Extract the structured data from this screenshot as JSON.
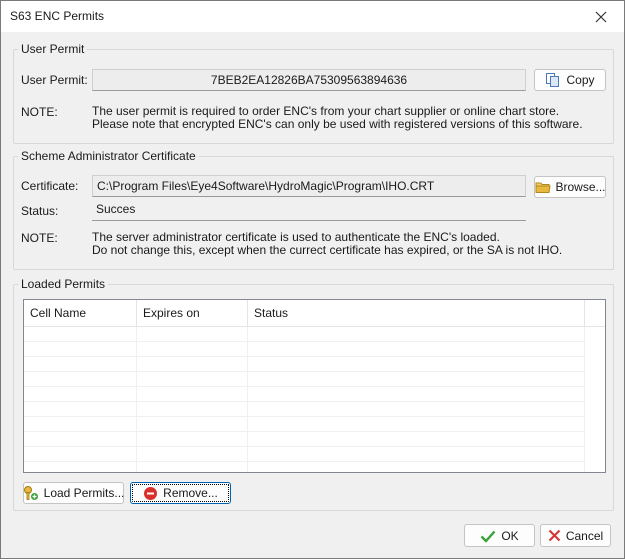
{
  "window": {
    "title": "S63 ENC Permits"
  },
  "user_permit": {
    "group_title": "User Permit",
    "label": "User Permit:",
    "value": "7BEB2EA12826BA75309563894636",
    "copy_button": "Copy",
    "note_label": "NOTE:",
    "note_line1": "The user permit is required to order ENC's from your chart supplier or online chart store.",
    "note_line2": "Please note that encrypted ENC's can only be used with registered versions of this software."
  },
  "certificate": {
    "group_title": "Scheme Administrator Certificate",
    "label": "Certificate:",
    "value": "C:\\Program Files\\Eye4Software\\HydroMagic\\Program\\IHO.CRT",
    "browse_button": "Browse...",
    "status_label": "Status:",
    "status_value": "Succes",
    "note_label": "NOTE:",
    "note_line1": "The server administrator certificate is used to authenticate the ENC's loaded.",
    "note_line2": "Do not change this, except when the currect certificate has expired, or the SA is not IHO."
  },
  "loaded_permits": {
    "group_title": "Loaded Permits",
    "columns": [
      "Cell Name",
      "Expires on",
      "Status"
    ],
    "rows": [],
    "load_button": "Load Permits...",
    "remove_button": "Remove..."
  },
  "footer": {
    "ok_button": "OK",
    "cancel_button": "Cancel"
  },
  "icons": {
    "copy": "copy-icon",
    "browse": "folder-icon",
    "load": "key-add-icon",
    "remove": "remove-icon",
    "ok": "checkmark-icon",
    "cancel": "x-icon",
    "close": "close-icon"
  },
  "colors": {
    "ok_green": "#3aa23a",
    "cancel_red": "#d23a3a",
    "remove_red": "#d9302b",
    "folder_yellow": "#e8b93e"
  }
}
